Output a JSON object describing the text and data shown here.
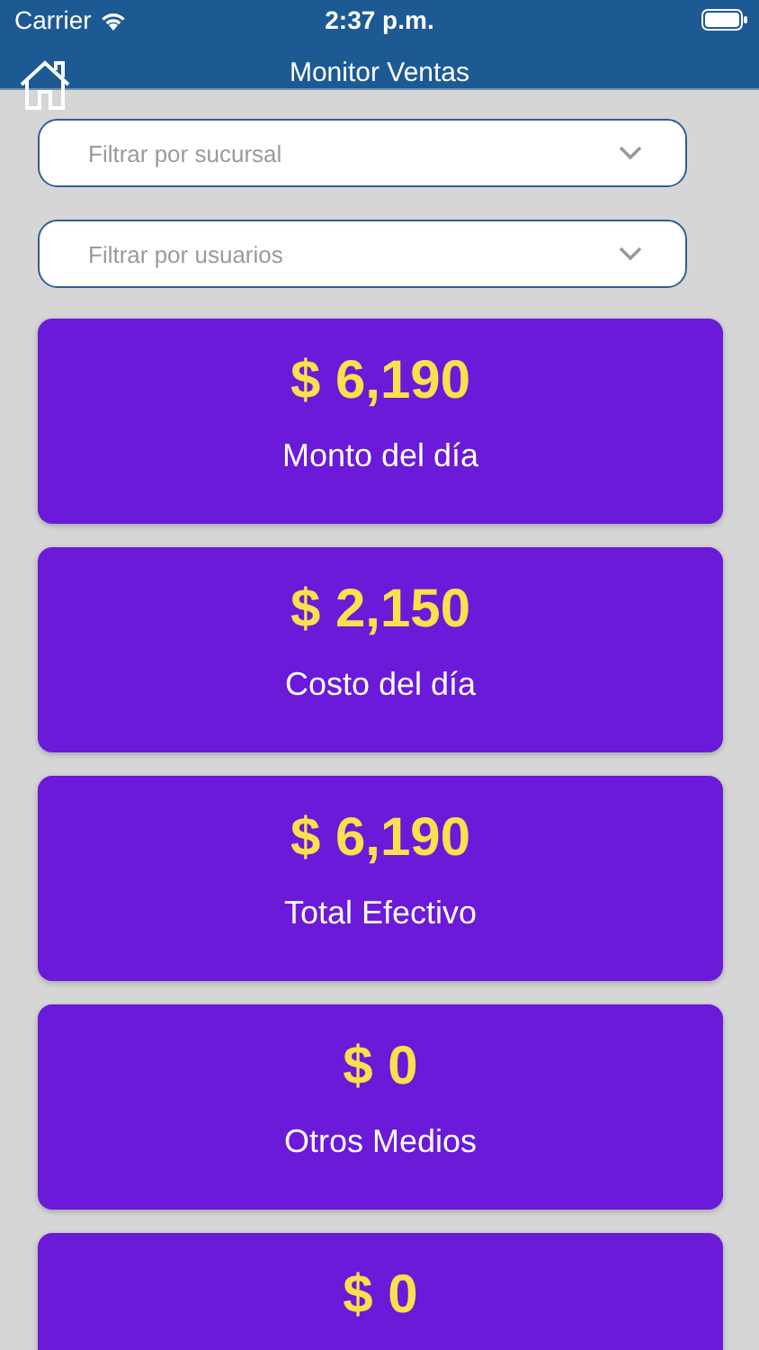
{
  "status_bar": {
    "carrier": "Carrier",
    "time": "2:37 p.m."
  },
  "header": {
    "title": "Monitor Ventas"
  },
  "filters": [
    {
      "placeholder": "Filtrar por sucursal"
    },
    {
      "placeholder": "Filtrar por usuarios"
    }
  ],
  "cards": [
    {
      "value": "$ 6,190",
      "label": "Monto del día"
    },
    {
      "value": "$ 2,150",
      "label": "Costo del día"
    },
    {
      "value": "$ 6,190",
      "label": "Total Efectivo"
    },
    {
      "value": "$ 0",
      "label": "Otros Medios"
    },
    {
      "value": "$ 0"
    }
  ]
}
